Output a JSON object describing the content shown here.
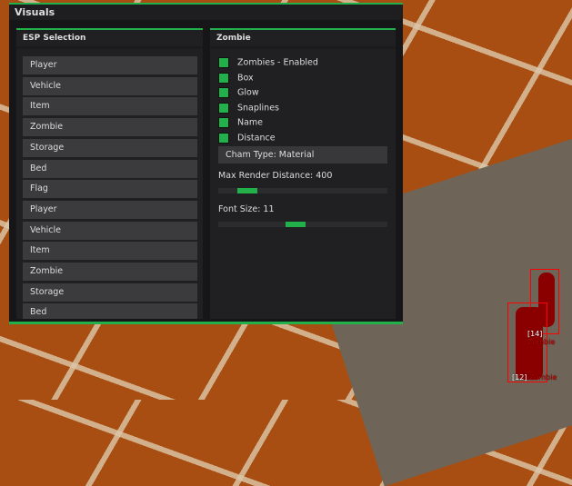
{
  "window": {
    "title": "Visuals"
  },
  "left_panel": {
    "title": "ESP Selection",
    "items": [
      "Player",
      "Vehicle",
      "Item",
      "Zombie",
      "Storage",
      "Bed",
      "Flag",
      "Player",
      "Vehicle",
      "Item",
      "Zombie",
      "Storage",
      "Bed"
    ]
  },
  "right_panel": {
    "title": "Zombie",
    "checkboxes": [
      {
        "label": "Zombies - Enabled",
        "checked": true
      },
      {
        "label": "Box",
        "checked": true
      },
      {
        "label": "Glow",
        "checked": true
      },
      {
        "label": "Snaplines",
        "checked": true
      },
      {
        "label": "Name",
        "checked": true
      },
      {
        "label": "Distance",
        "checked": true
      }
    ],
    "cham_type": "Cham Type: Material",
    "max_render_label": "Max Render Distance: 400",
    "max_render_fraction": 0.2,
    "font_size_label": "Font Size: 11",
    "font_size_fraction": 0.45
  },
  "esp_tags": [
    {
      "dist": "[14]",
      "name": "Zombie"
    },
    {
      "dist": "[12]",
      "name": "Zombie"
    }
  ],
  "colors": {
    "accent": "#22b04a",
    "esp": "#ff0000"
  }
}
